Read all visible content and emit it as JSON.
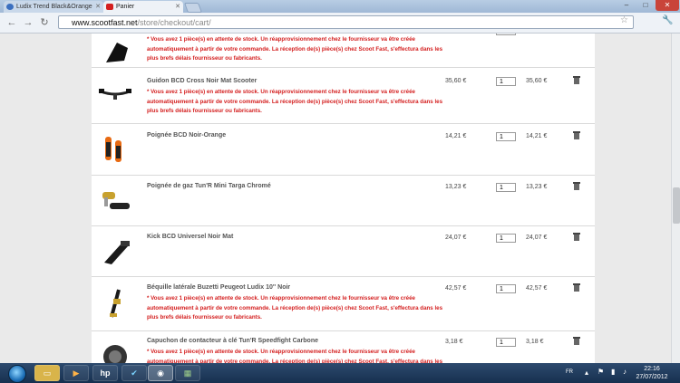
{
  "browser": {
    "tabs": [
      {
        "title": "Ludix Trend Black&Orange",
        "active": false
      },
      {
        "title": "Panier",
        "active": true
      }
    ],
    "url_host": "www.scootfast.net",
    "url_path": "/store/checkout/cart/",
    "window_controls": {
      "minimize": "–",
      "maximize": "□",
      "close": "✕"
    }
  },
  "cart": {
    "stock_warning": "* Vous avez 1 pièce(s) en attente de stock. Un réapprovisionnement chez le fournisseur va être créée automatiquement à partir de votre commande. La réception de(s) pièce(s) chez Scoot Fast, s'effectura dans les plus brefs délais fournisseur ou fabricants.",
    "items": [
      {
        "name": "",
        "price": "",
        "qty": "1",
        "total": "",
        "warning": true
      },
      {
        "name": "Guidon BCD Cross Noir Mat Scooter",
        "price": "35,60 €",
        "qty": "1",
        "total": "35,60 €",
        "warning": true
      },
      {
        "name": "Poignée BCD Noir-Orange",
        "price": "14,21 €",
        "qty": "1",
        "total": "14,21 €",
        "warning": false
      },
      {
        "name": "Poignée de gaz Tun'R Mini Targa Chromé",
        "price": "13,23 €",
        "qty": "1",
        "total": "13,23 €",
        "warning": false
      },
      {
        "name": "Kick BCD Universel Noir Mat",
        "price": "24,07 €",
        "qty": "1",
        "total": "24,07 €",
        "warning": false
      },
      {
        "name": "Béquille latérale Buzetti Peugeot Ludix 10'' Noir",
        "price": "42,57 €",
        "qty": "1",
        "total": "42,57 €",
        "warning": true
      },
      {
        "name": "Capuchon de contacteur à clé Tun'R Speedfight Carbone",
        "price": "3,18 €",
        "qty": "1",
        "total": "3,18 €",
        "warning": true
      }
    ]
  },
  "taskbar": {
    "lang": "FR",
    "time": "22:16",
    "date": "27/07/2012",
    "apps": [
      "explorer-icon",
      "media-player-icon",
      "hp-icon",
      "app-icon",
      "chrome-icon",
      "network-icon"
    ]
  },
  "colors": {
    "warning": "#d42020",
    "taskbar": "#1f3a5c",
    "background": "#eaeaea"
  }
}
